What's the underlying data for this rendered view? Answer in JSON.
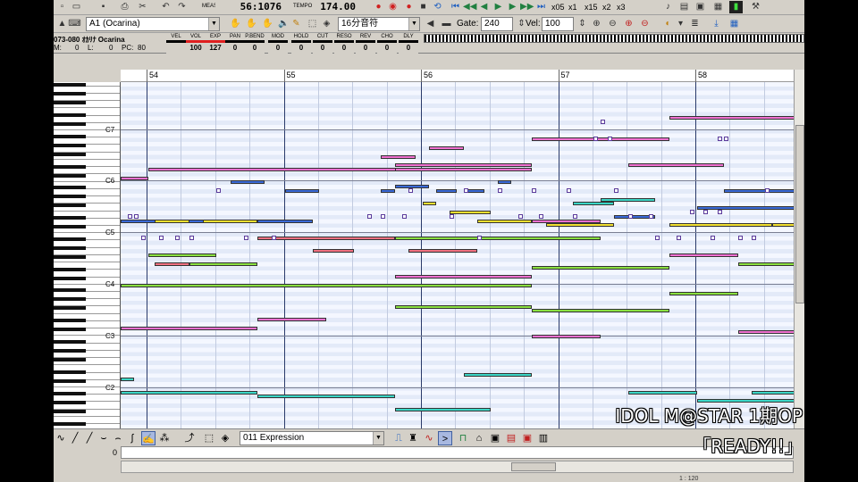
{
  "toolbar": {
    "meas_label": "MEAS",
    "meas_value": "56:1076",
    "tempo_label": "TEMPO",
    "tempo_value": "174.00",
    "speeds": [
      "x05",
      "x1",
      "x15",
      "x2",
      "x3"
    ],
    "track": "A1 (Ocarina)",
    "note_length": "16分音符",
    "gate_label": "Gate:",
    "gate_value": "240",
    "vel_label": "Vel:",
    "vel_value": "100"
  },
  "track_info": {
    "name": "073-080 ｵｶﾘﾅ Ocarina",
    "sub_labels": [
      "M:",
      "L:",
      "PC:"
    ],
    "sub_values": [
      "0",
      "0",
      "80"
    ],
    "controls": [
      {
        "label": "VEL",
        "value": "",
        "color": "#000000"
      },
      {
        "label": "VOL",
        "value": "100",
        "color": "#e02020"
      },
      {
        "label": "EXP",
        "value": "127",
        "color": "#e02020"
      },
      {
        "label": "PAN",
        "value": "0",
        "color": "#000000"
      },
      {
        "label": "P.BEND",
        "value": "0",
        "color": "#000000"
      },
      {
        "label": "MOD",
        "value": "0",
        "color": "#000000"
      },
      {
        "label": "HOLD",
        "value": "0",
        "color": "#000000"
      },
      {
        "label": "CUT",
        "value": "0",
        "color": "#000000"
      },
      {
        "label": "RESO",
        "value": "0",
        "color": "#000000"
      },
      {
        "label": "REV",
        "value": "0",
        "color": "#000000"
      },
      {
        "label": "CHO",
        "value": "0",
        "color": "#000000"
      },
      {
        "label": "DLY",
        "value": "0",
        "color": "#000000"
      }
    ]
  },
  "ruler": {
    "measures": [
      "54",
      "55",
      "56",
      "57",
      "58"
    ]
  },
  "keyboard": {
    "octave_labels": [
      "C7",
      "C6",
      "C5",
      "C4",
      "C3",
      "C2"
    ]
  },
  "notes": [
    {
      "m": 0.0,
      "row": 22,
      "len": 0.2,
      "color": "#f070d0"
    },
    {
      "m": 0.2,
      "row": 20,
      "len": 1.9,
      "color": "#f070d0"
    },
    {
      "m": 2.0,
      "row": 19,
      "len": 1.0,
      "color": "#f070d0"
    },
    {
      "m": 1.9,
      "row": 17,
      "len": 0.25,
      "color": "#f070d0"
    },
    {
      "m": 2.25,
      "row": 15,
      "len": 0.25,
      "color": "#f070d0"
    },
    {
      "m": 2.0,
      "row": 20,
      "len": 1.0,
      "color": "#f070d0"
    },
    {
      "m": 3.0,
      "row": 13,
      "len": 1.0,
      "color": "#f070d0"
    },
    {
      "m": 4.0,
      "row": 8,
      "len": 1.0,
      "color": "#f070d0"
    },
    {
      "m": 3.7,
      "row": 19,
      "len": 0.7,
      "color": "#f070d0"
    },
    {
      "m": 0.8,
      "row": 23,
      "len": 0.25,
      "color": "#3a6ad8"
    },
    {
      "m": 1.2,
      "row": 25,
      "len": 0.25,
      "color": "#3a6ad8"
    },
    {
      "m": 1.9,
      "row": 25,
      "len": 0.1,
      "color": "#3a6ad8"
    },
    {
      "m": 2.0,
      "row": 24,
      "len": 0.25,
      "color": "#3a6ad8"
    },
    {
      "m": 2.3,
      "row": 25,
      "len": 0.15,
      "color": "#3a6ad8"
    },
    {
      "m": 2.5,
      "row": 25,
      "len": 0.15,
      "color": "#3a6ad8"
    },
    {
      "m": 2.75,
      "row": 23,
      "len": 0.1,
      "color": "#3a6ad8"
    },
    {
      "m": 3.6,
      "row": 31,
      "len": 0.3,
      "color": "#3a6ad8"
    },
    {
      "m": 4.4,
      "row": 25,
      "len": 0.6,
      "color": "#3a6ad8"
    },
    {
      "m": 4.2,
      "row": 29,
      "len": 0.8,
      "color": "#3a6ad8"
    },
    {
      "m": 0.0,
      "row": 32,
      "len": 1.0,
      "color": "#3a6ad8"
    },
    {
      "m": 1.0,
      "row": 32,
      "len": 0.4,
      "color": "#3a6ad8"
    },
    {
      "m": 3.0,
      "row": 32,
      "len": 0.5,
      "color": "#f070d0"
    },
    {
      "m": 0.25,
      "row": 32,
      "len": 0.25,
      "color": "#f2e030"
    },
    {
      "m": 0.6,
      "row": 32,
      "len": 0.4,
      "color": "#f2e030"
    },
    {
      "m": 2.6,
      "row": 32,
      "len": 0.4,
      "color": "#f2e030"
    },
    {
      "m": 3.1,
      "row": 33,
      "len": 0.5,
      "color": "#f2e030"
    },
    {
      "m": 4.0,
      "row": 33,
      "len": 0.75,
      "color": "#f2e030"
    },
    {
      "m": 4.75,
      "row": 33,
      "len": 0.25,
      "color": "#f2e030"
    },
    {
      "m": 2.2,
      "row": 28,
      "len": 0.1,
      "color": "#f2e030"
    },
    {
      "m": 2.4,
      "row": 30,
      "len": 0.3,
      "color": "#f2e030"
    },
    {
      "m": 3.3,
      "row": 28,
      "len": 0.3,
      "color": "#3bd6c6"
    },
    {
      "m": 3.5,
      "row": 27,
      "len": 0.4,
      "color": "#3bd6c6"
    },
    {
      "m": 0.2,
      "row": 40,
      "len": 0.5,
      "color": "#8ae040"
    },
    {
      "m": 0.5,
      "row": 42,
      "len": 0.5,
      "color": "#8ae040"
    },
    {
      "m": 0.0,
      "row": 47,
      "len": 3.0,
      "color": "#8ae040"
    },
    {
      "m": 2.0,
      "row": 52,
      "len": 1.0,
      "color": "#8ae040"
    },
    {
      "m": 3.0,
      "row": 43,
      "len": 1.0,
      "color": "#8ae040"
    },
    {
      "m": 3.0,
      "row": 53,
      "len": 1.0,
      "color": "#8ae040"
    },
    {
      "m": 4.0,
      "row": 49,
      "len": 0.5,
      "color": "#8ae040"
    },
    {
      "m": 4.5,
      "row": 42,
      "len": 0.5,
      "color": "#8ae040"
    },
    {
      "m": 2.0,
      "row": 36,
      "len": 1.5,
      "color": "#8ae040"
    },
    {
      "m": 1.0,
      "row": 36,
      "len": 1.0,
      "color": "#f07080"
    },
    {
      "m": 2.1,
      "row": 39,
      "len": 0.5,
      "color": "#f07080"
    },
    {
      "m": 1.4,
      "row": 39,
      "len": 0.3,
      "color": "#f07080"
    },
    {
      "m": 0.25,
      "row": 42,
      "len": 0.25,
      "color": "#f07080"
    },
    {
      "m": 0.0,
      "row": 57,
      "len": 1.0,
      "color": "#f070d0"
    },
    {
      "m": 1.0,
      "row": 55,
      "len": 0.5,
      "color": "#f070d0"
    },
    {
      "m": 2.0,
      "row": 45,
      "len": 1.0,
      "color": "#f070d0"
    },
    {
      "m": 3.0,
      "row": 59,
      "len": 0.5,
      "color": "#f070d0"
    },
    {
      "m": 4.0,
      "row": 40,
      "len": 0.5,
      "color": "#f070d0"
    },
    {
      "m": 4.5,
      "row": 58,
      "len": 0.5,
      "color": "#f070d0"
    },
    {
      "m": 0.0,
      "row": 72,
      "len": 1.0,
      "color": "#3bd6c6"
    },
    {
      "m": 1.0,
      "row": 73,
      "len": 1.0,
      "color": "#3bd6c6"
    },
    {
      "m": 2.0,
      "row": 76,
      "len": 0.7,
      "color": "#3bd6c6"
    },
    {
      "m": 3.7,
      "row": 72,
      "len": 0.5,
      "color": "#3bd6c6"
    },
    {
      "m": 4.6,
      "row": 72,
      "len": 0.4,
      "color": "#3bd6c6"
    },
    {
      "m": 4.2,
      "row": 74,
      "len": 0.8,
      "color": "#3bd6c6"
    },
    {
      "m": 0.0,
      "row": 69,
      "len": 0.1,
      "color": "#3bd6c6"
    },
    {
      "m": 2.5,
      "row": 68,
      "len": 0.5,
      "color": "#3bd6c6"
    }
  ],
  "dots": [
    {
      "m": 0.05,
      "row": 31
    },
    {
      "m": 0.1,
      "row": 31
    },
    {
      "m": 0.15,
      "row": 36
    },
    {
      "m": 0.28,
      "row": 36
    },
    {
      "m": 0.4,
      "row": 36
    },
    {
      "m": 0.5,
      "row": 36
    },
    {
      "m": 0.9,
      "row": 36
    },
    {
      "m": 1.1,
      "row": 36
    },
    {
      "m": 0.7,
      "row": 25
    },
    {
      "m": 1.8,
      "row": 31
    },
    {
      "m": 1.9,
      "row": 31
    },
    {
      "m": 2.05,
      "row": 31
    },
    {
      "m": 2.4,
      "row": 31
    },
    {
      "m": 2.6,
      "row": 36
    },
    {
      "m": 2.1,
      "row": 25
    },
    {
      "m": 2.5,
      "row": 25
    },
    {
      "m": 2.75,
      "row": 25
    },
    {
      "m": 3.0,
      "row": 25
    },
    {
      "m": 3.25,
      "row": 25
    },
    {
      "m": 3.45,
      "row": 13
    },
    {
      "m": 3.55,
      "row": 13
    },
    {
      "m": 3.5,
      "row": 9
    },
    {
      "m": 3.6,
      "row": 25
    },
    {
      "m": 3.7,
      "row": 31
    },
    {
      "m": 3.85,
      "row": 31
    },
    {
      "m": 3.9,
      "row": 36
    },
    {
      "m": 4.05,
      "row": 36
    },
    {
      "m": 4.35,
      "row": 30
    },
    {
      "m": 4.4,
      "row": 13
    },
    {
      "m": 4.25,
      "row": 30
    },
    {
      "m": 4.15,
      "row": 30
    },
    {
      "m": 4.3,
      "row": 36
    },
    {
      "m": 4.5,
      "row": 36
    },
    {
      "m": 4.6,
      "row": 36
    },
    {
      "m": 4.7,
      "row": 25
    },
    {
      "m": 4.35,
      "row": 13
    },
    {
      "m": 3.05,
      "row": 31
    },
    {
      "m": 3.3,
      "row": 31
    },
    {
      "m": 2.9,
      "row": 31
    }
  ],
  "bottom_toolbar": {
    "controller_select": "011 Expression"
  },
  "controller": {
    "zero_label": "0",
    "zoom_label": "1 : 120"
  },
  "caption": {
    "line1": "IDOL M@STAR 1期OP",
    "line2": "「READY!!」"
  }
}
